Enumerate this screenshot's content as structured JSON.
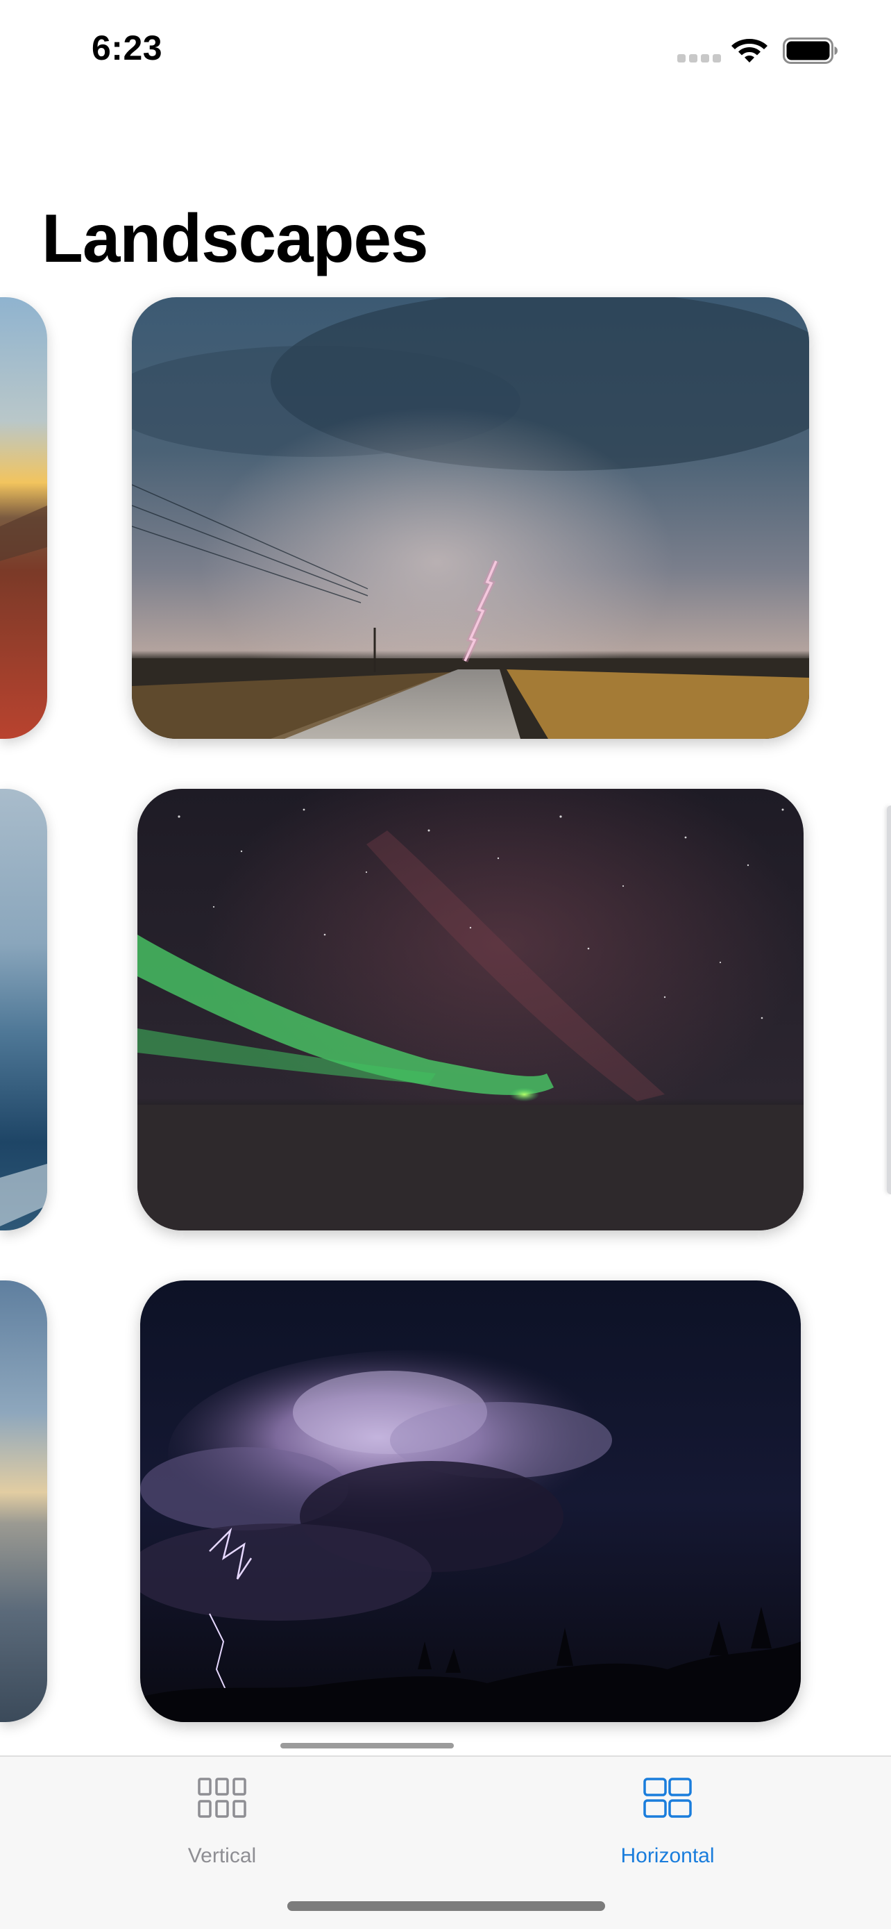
{
  "status_bar": {
    "time": "6:23"
  },
  "header": {
    "title": "Landscapes"
  },
  "gallery": {
    "rows": [
      {
        "center_image": "storm-lightning-road",
        "left_peek_image": "desert-sunset"
      },
      {
        "center_image": "aurora-night-sky",
        "left_peek_image": "ocean-coast"
      },
      {
        "center_image": "night-thunderstorm",
        "left_peek_image": "ocean-sunset"
      }
    ]
  },
  "tab_bar": {
    "tabs": [
      {
        "label": "Vertical",
        "icon": "grid-3x2-icon",
        "selected": false
      },
      {
        "label": "Horizontal",
        "icon": "grid-2x2-icon",
        "selected": true
      }
    ]
  },
  "colors": {
    "accent": "#1a7ddc",
    "inactive_tab": "#8e8e93",
    "tab_bar_background": "#f7f7f7"
  }
}
